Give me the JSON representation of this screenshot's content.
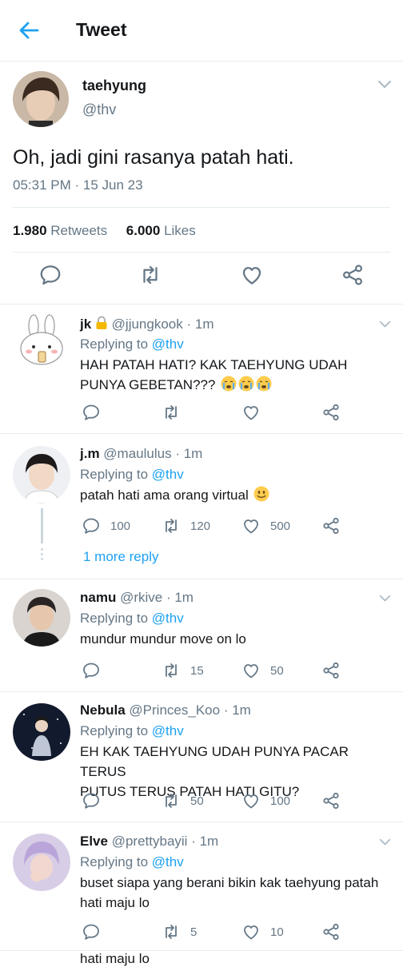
{
  "header": {
    "title": "Tweet",
    "back_icon": "arrow-left-icon"
  },
  "tweet": {
    "name": "taehyung",
    "handle": "@thv",
    "text": "Oh, jadi gini rasanya patah hati.",
    "timestamp": "05:31 PM · 15 Jun 23",
    "retweets_count": "1.980",
    "retweets_label": "Retweets",
    "likes_count": "6.000",
    "likes_label": "Likes",
    "actions": [
      "reply-icon",
      "retweet-icon",
      "like-icon",
      "share-icon"
    ]
  },
  "replies": [
    {
      "name": "jk",
      "badge": "lock-icon",
      "handle": "@jjungkook",
      "time": "· 1m",
      "replying_label": "Replying to",
      "replying_to": "@thv",
      "text_line1": "HAH PATAH HATI? KAK TAEHYUNG UDAH",
      "text_line2": "PUNYA GEBETAN???",
      "emoji": "crying-emoji x3",
      "replies": "",
      "retweets": "",
      "likes": ""
    },
    {
      "name": "j.m",
      "handle": "@maululus",
      "time": "· 1m",
      "replying_label": "Replying to",
      "replying_to": "@thv",
      "text": "patah hati ama orang virtual",
      "emoji": "smiley-emoji",
      "replies": "100",
      "retweets": "120",
      "likes": "500",
      "more_reply": "1 more reply"
    },
    {
      "name": "namu",
      "handle": "@rkive",
      "time": "· 1m",
      "replying_label": "Replying to",
      "replying_to": "@thv",
      "text": "mundur mundur move on lo",
      "replies": "",
      "retweets": "15",
      "likes": "50"
    },
    {
      "name": "Nebula",
      "handle": "@Princes_Koo",
      "time": "· 1m",
      "replying_label": "Replying to",
      "replying_to": "@thv",
      "text_line1": "EH KAK TAEHYUNG UDAH PUNYA PACAR TERUS",
      "text_line2": "PUTUS TERUS PATAH HATI GITU?",
      "replies": "",
      "retweets": "50",
      "likes": "100"
    },
    {
      "name": "Elve",
      "handle": "@prettybayii",
      "time": "· 1m",
      "replying_label": "Replying to",
      "replying_to": "@thv",
      "text_line1": "buset siapa yang berani bikin kak taehyung patah",
      "text_line2": "hati maju lo",
      "replies": "",
      "retweets": "5",
      "likes": "10"
    }
  ],
  "peek_text": "hati maju lo",
  "colors": {
    "accent": "#1da1f2",
    "muted": "#657786",
    "divider": "#e6ecf0"
  }
}
